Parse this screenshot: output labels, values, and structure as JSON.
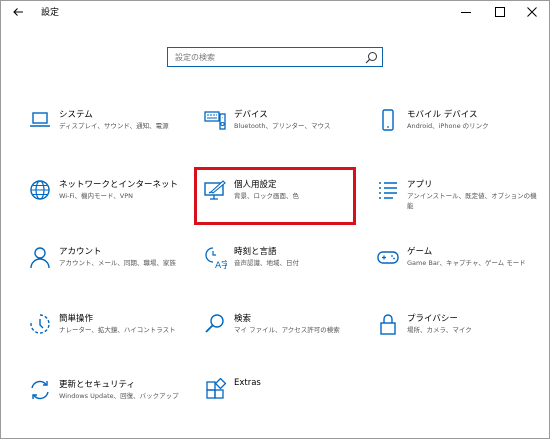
{
  "window": {
    "title": "設定",
    "back_icon": "arrow-left-icon",
    "minimize_icon": "minimize-icon",
    "maximize_icon": "maximize-icon",
    "close_icon": "close-icon"
  },
  "search": {
    "placeholder": "設定の検索",
    "icon": "search-icon"
  },
  "accent_color": "#0067c0",
  "highlight_color": "#d8101c",
  "tiles": [
    {
      "title": "システム",
      "desc": "ディスプレイ、サウンド、通知、電源",
      "icon": "laptop-icon"
    },
    {
      "title": "デバイス",
      "desc": "Bluetooth、プリンター、マウス",
      "icon": "keyboard-speaker-icon"
    },
    {
      "title": "モバイル デバイス",
      "desc": "Android、iPhone のリンク",
      "icon": "phone-icon"
    },
    {
      "title": "ネットワークとインターネット",
      "desc": "Wi-Fi、機内モード、VPN",
      "icon": "globe-icon"
    },
    {
      "title": "個人用設定",
      "desc": "背景、ロック画面、色",
      "icon": "monitor-pen-icon"
    },
    {
      "title": "アプリ",
      "desc": "アンインストール、既定値、オプションの機能",
      "icon": "app-list-icon"
    },
    {
      "title": "アカウント",
      "desc": "アカウント、メール、同期、職場、家族",
      "icon": "person-icon"
    },
    {
      "title": "時刻と言語",
      "desc": "音声認識、地域、日付",
      "icon": "time-language-icon"
    },
    {
      "title": "ゲーム",
      "desc": "Game Bar、キャプチャ、ゲーム モード",
      "icon": "gamepad-icon"
    },
    {
      "title": "簡単操作",
      "desc": "ナレーター、拡大鏡、ハイコントラスト",
      "icon": "ease-of-access-icon"
    },
    {
      "title": "検索",
      "desc": "マイ ファイル、アクセス許可の検索",
      "icon": "magnifier-icon"
    },
    {
      "title": "プライバシー",
      "desc": "場所、カメラ、マイク",
      "icon": "lock-icon"
    },
    {
      "title": "更新とセキュリティ",
      "desc": "Windows Update、回復、バックアップ",
      "icon": "sync-icon"
    },
    {
      "title": "Extras",
      "desc": "",
      "icon": "extras-blocks-icon"
    }
  ]
}
